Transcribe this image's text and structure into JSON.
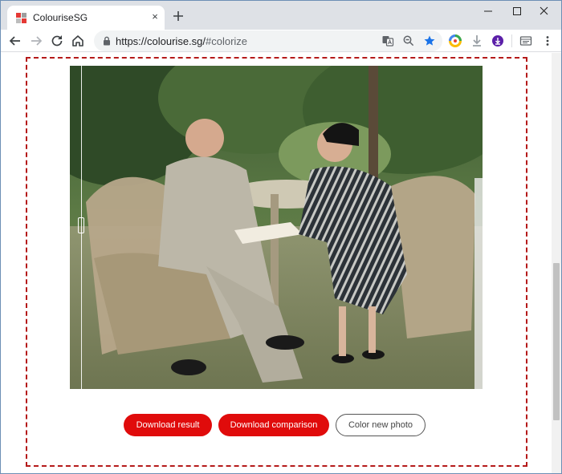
{
  "browser": {
    "tab_title": "ColouriseSG",
    "tab_close_glyph": "×",
    "url_host": "https://colourise.sg/",
    "url_rest": "#colorize"
  },
  "toolbar_icons": [
    "back-arrow-icon",
    "forward-arrow-icon",
    "reload-icon",
    "home-icon",
    "lock-icon",
    "translate-icon",
    "zoom-icon",
    "bookmark-star-icon",
    "extension-color-icon",
    "download-arrow-icon",
    "extension-purple-icon",
    "cast-icon",
    "menu-dots-icon"
  ],
  "colors": {
    "accent_red": "#e00b0b",
    "frame_dashed": "#b51a1a",
    "bookmark_blue": "#1a73e8"
  },
  "actions": {
    "download_result": "Download result",
    "download_comparison": "Download comparison",
    "color_new_photo": "Color new photo"
  }
}
